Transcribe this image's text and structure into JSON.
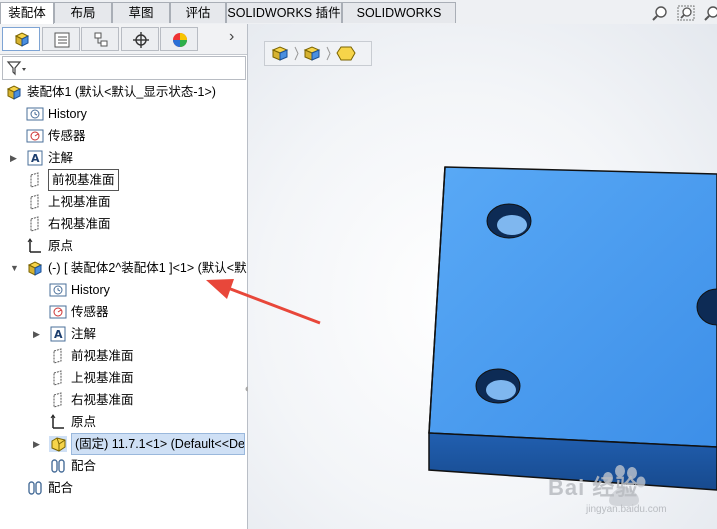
{
  "tabs": [
    {
      "label": "装配体",
      "active": true
    },
    {
      "label": "布局",
      "active": false
    },
    {
      "label": "草图",
      "active": false
    },
    {
      "label": "评估",
      "active": false
    },
    {
      "label": "SOLIDWORKS 插件",
      "active": false
    },
    {
      "label": "SOLIDWORKS MBD",
      "active": false
    }
  ],
  "panel_tabs": [
    {
      "icon": "feature-manager-icon"
    },
    {
      "icon": "property-manager-icon"
    },
    {
      "icon": "configuration-manager-icon"
    },
    {
      "icon": "dimxpert-icon"
    },
    {
      "icon": "display-manager-icon"
    }
  ],
  "tree": [
    {
      "label": "装配体1 (默认<默认_显示状态-1>)",
      "icon": "assembly-icon",
      "expand": ""
    },
    {
      "label": "History",
      "icon": "history-icon",
      "expand": ""
    },
    {
      "label": "传感器",
      "icon": "sensor-icon",
      "expand": ""
    },
    {
      "label": "注解",
      "icon": "annotation-icon",
      "expand": "▶"
    },
    {
      "label": "前视基准面",
      "icon": "plane-icon",
      "expand": ""
    },
    {
      "label": "上视基准面",
      "icon": "plane-icon",
      "expand": ""
    },
    {
      "label": "右视基准面",
      "icon": "plane-icon",
      "expand": ""
    },
    {
      "label": "原点",
      "icon": "origin-icon",
      "expand": ""
    },
    {
      "label": "(-) [ 装配体2^装配体1 ]<1> (默认<默",
      "icon": "subassembly-icon",
      "expand": "▼"
    },
    {
      "label": "History",
      "icon": "history-icon",
      "expand": ""
    },
    {
      "label": "传感器",
      "icon": "sensor-icon",
      "expand": ""
    },
    {
      "label": "注解",
      "icon": "annotation-icon",
      "expand": "▶"
    },
    {
      "label": "前视基准面",
      "icon": "plane-icon",
      "expand": ""
    },
    {
      "label": "上视基准面",
      "icon": "plane-icon",
      "expand": ""
    },
    {
      "label": "右视基准面",
      "icon": "plane-icon",
      "expand": ""
    },
    {
      "label": "原点",
      "icon": "origin-icon",
      "expand": ""
    },
    {
      "label": "(固定) 11.7.1<1> (Default<<De",
      "icon": "part-icon",
      "expand": "▶"
    },
    {
      "label": "配合",
      "icon": "mates-icon",
      "expand": ""
    },
    {
      "label": "配合",
      "icon": "mates-icon",
      "expand": ""
    }
  ],
  "colors": {
    "part_top": "#4a9cf0",
    "part_side": "#1f5fb4",
    "arrow": "#e8473a",
    "accent": "#2f6fc4"
  },
  "watermark": {
    "text": "Bai 经验",
    "sub": "jingyan.baidu.com"
  }
}
